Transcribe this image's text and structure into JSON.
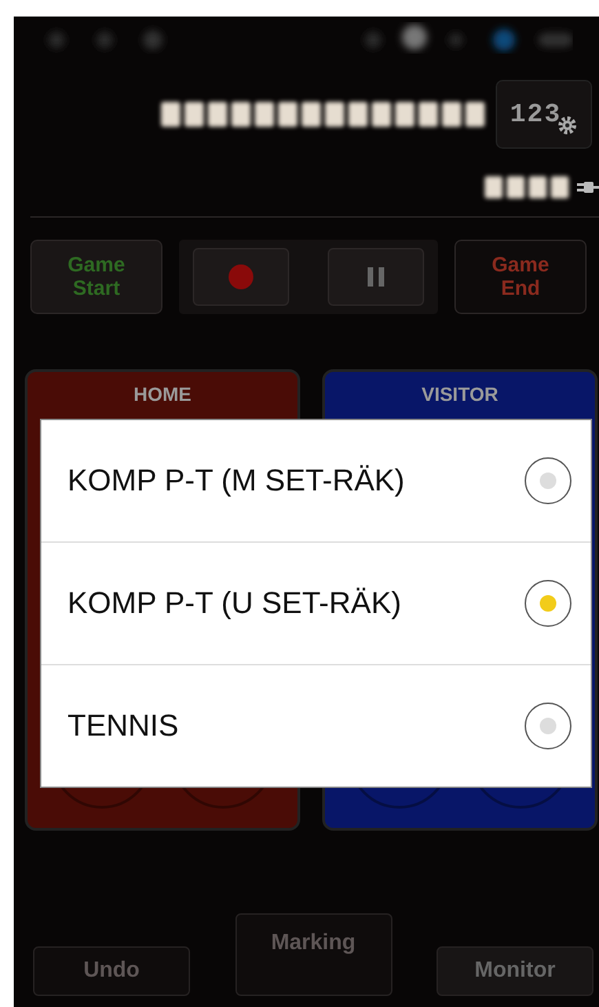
{
  "toolbar": {
    "counter_button": {
      "label": "123"
    }
  },
  "controls": [
    {
      "label": "Game\nStart",
      "kind": "start",
      "disabled": false
    },
    {
      "label": "Game\nEnd",
      "kind": "end",
      "disabled": true
    }
  ],
  "teams": [
    {
      "name": "HOME",
      "kind": "home"
    },
    {
      "name": "VISITOR",
      "kind": "visitor"
    }
  ],
  "dialog": {
    "options": [
      {
        "label": "KOMP P-T (M SET-RÄK)",
        "selected": false
      },
      {
        "label": "KOMP P-T (U SET-RÄK)",
        "selected": true
      },
      {
        "label": "TENNIS",
        "selected": false
      }
    ]
  },
  "bottom_buttons": [
    {
      "label": "Undo",
      "disabled": true
    },
    {
      "label": "Marking",
      "disabled": true
    },
    {
      "label": "Monitor",
      "disabled": false
    }
  ]
}
